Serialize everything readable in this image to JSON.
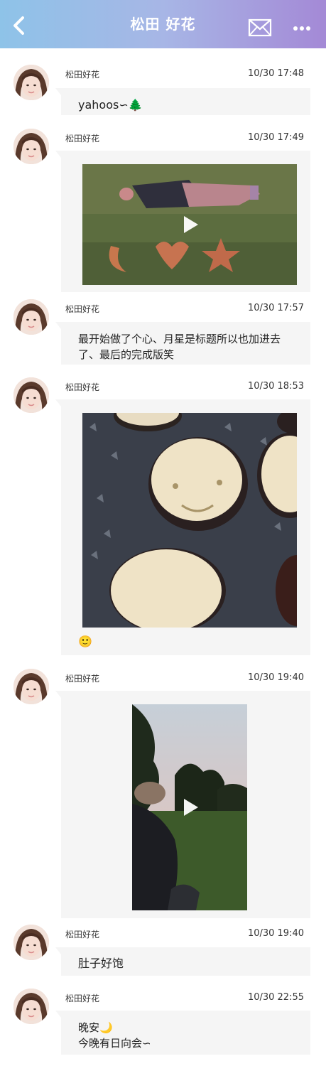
{
  "header": {
    "title": "松田 好花",
    "back_icon": "chevron-left-icon",
    "mail_icon": "envelope-icon",
    "more_icon": "ellipsis-icon"
  },
  "messages": [
    {
      "sender": "松田好花",
      "time": "10/30 17:48",
      "text": "yahoos∽🌲"
    },
    {
      "sender": "松田好花",
      "time": "10/30 17:49",
      "media": "video"
    },
    {
      "sender": "松田好花",
      "time": "10/30 17:57",
      "text_line1": "最开始做了个心、月星是标题所以也加进去",
      "text_line2": "了、最后的完成版笑"
    },
    {
      "sender": "松田好花",
      "time": "10/30 18:53",
      "media": "photo",
      "caption": "🙂"
    },
    {
      "sender": "松田好花",
      "time": "10/30 19:40",
      "media": "video"
    },
    {
      "sender": "松田好花",
      "time": "10/30 19:40",
      "text": "肚子好饱"
    },
    {
      "sender": "松田好花",
      "time": "10/30 22:55",
      "text_line1": "晚安🌙",
      "text_line2": "今晚有日向会∽"
    }
  ],
  "colors": {
    "header_start": "#8ec3e8",
    "header_end": "#a489d6",
    "bubble": "#f5f5f5"
  }
}
